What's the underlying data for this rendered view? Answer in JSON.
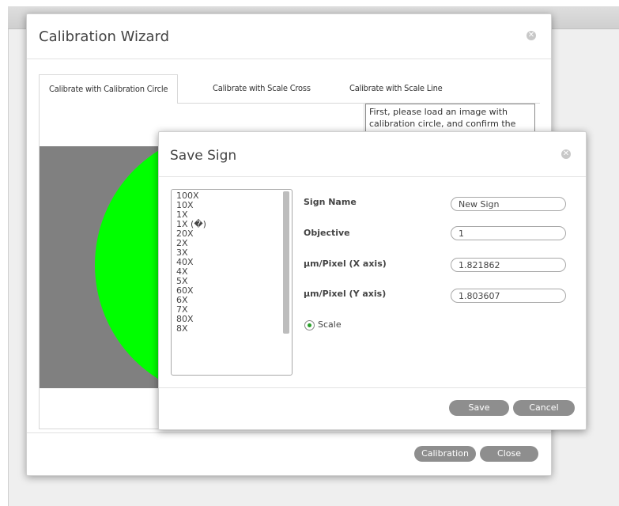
{
  "wizard": {
    "title": "Calibration Wizard",
    "tabs": [
      {
        "label": "Calibrate with Calibration Circle",
        "active": true
      },
      {
        "label": "Calibrate with Scale Cross",
        "active": false
      },
      {
        "label": "Calibrate with Scale Line",
        "active": false
      }
    ],
    "info_text": "First, please load an image with calibration circle, and confirm the",
    "buttons": {
      "calibration": "Calibration",
      "close": "Close"
    }
  },
  "save_sign": {
    "title": "Save Sign",
    "list_items": [
      "100X",
      "10X",
      "1X",
      "1X (�)",
      "20X",
      "2X",
      "3X",
      "40X",
      "4X",
      "5X",
      "60X",
      "6X",
      "7X",
      "80X",
      "8X"
    ],
    "fields": {
      "sign_name": {
        "label": "Sign Name",
        "value": "New Sign"
      },
      "objective": {
        "label": "Objective",
        "value": "1"
      },
      "px_x": {
        "label": "µm/Pixel (X axis)",
        "value": "1.821862"
      },
      "px_y": {
        "label": "µm/Pixel (Y axis)",
        "value": "1.803607"
      }
    },
    "radio_label": "Scale",
    "buttons": {
      "save": "Save",
      "cancel": "Cancel"
    }
  },
  "colors": {
    "accent_green": "#00ff00",
    "button_gray": "#8e8e8e",
    "image_gray": "#808080"
  }
}
